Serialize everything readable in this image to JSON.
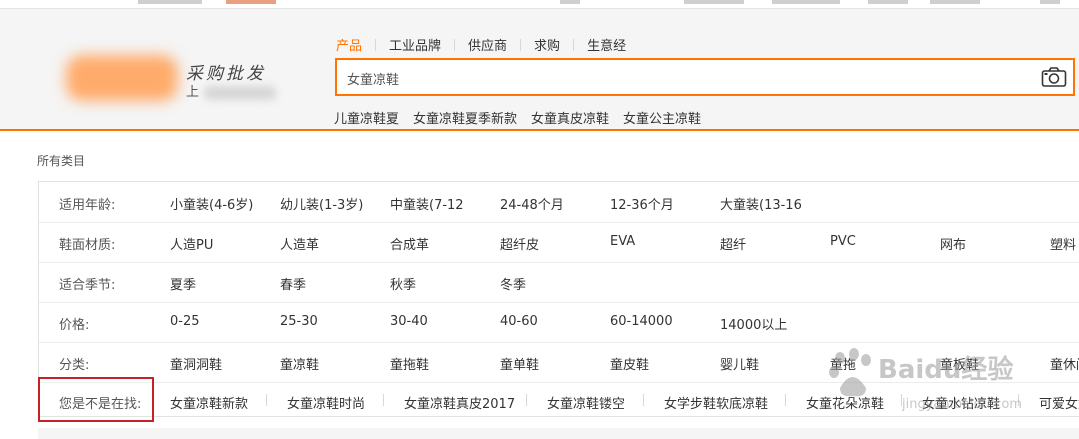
{
  "header": {
    "logo_text": "采购批发",
    "logo_sub": "上",
    "tabs": [
      "产品",
      "工业品牌",
      "供应商",
      "求购",
      "生意经"
    ],
    "active_tab": "产品",
    "search_value": "女童凉鞋",
    "hotwords": [
      "儿童凉鞋夏",
      "女童凉鞋夏季新款",
      "女童真皮凉鞋",
      "女童公主凉鞋"
    ],
    "accent_color": "#ff7300"
  },
  "breadcrumb": "所有类目",
  "filters": [
    {
      "label": "适用年龄:",
      "options": [
        "小童装(4-6岁)",
        "幼儿装(1-3岁)",
        "中童装(7-12",
        "24-48个月",
        "12-36个月",
        "大童装(13-16"
      ]
    },
    {
      "label": "鞋面材质:",
      "options": [
        "人造PU",
        "人造革",
        "合成革",
        "超纤皮",
        "EVA",
        "超纤",
        "PVC",
        "网布",
        "塑料"
      ]
    },
    {
      "label": "适合季节:",
      "options": [
        "夏季",
        "春季",
        "秋季",
        "冬季"
      ]
    },
    {
      "label": "价格:",
      "options": [
        "0-25",
        "25-30",
        "30-40",
        "40-60",
        "60-14000",
        "14000以上"
      ]
    },
    {
      "label": "分类:",
      "options": [
        "童洞洞鞋",
        "童凉鞋",
        "童拖鞋",
        "童单鞋",
        "童皮鞋",
        "婴儿鞋",
        "童拖",
        "童板鞋",
        "童休闲"
      ]
    }
  ],
  "seeking": {
    "label": "您是不是在找:",
    "items": [
      "女童凉鞋新款",
      "女童凉鞋时尚",
      "女童凉鞋真皮2017",
      "女童凉鞋镂空",
      "女学步鞋软底凉鞋",
      "女童花朵凉鞋",
      "女童水钻凉鞋",
      "可爱女童"
    ]
  },
  "watermark": {
    "text": "Baidu经验",
    "url": "jingyan.baidu.com"
  },
  "icons": {
    "camera": "camera-icon"
  }
}
